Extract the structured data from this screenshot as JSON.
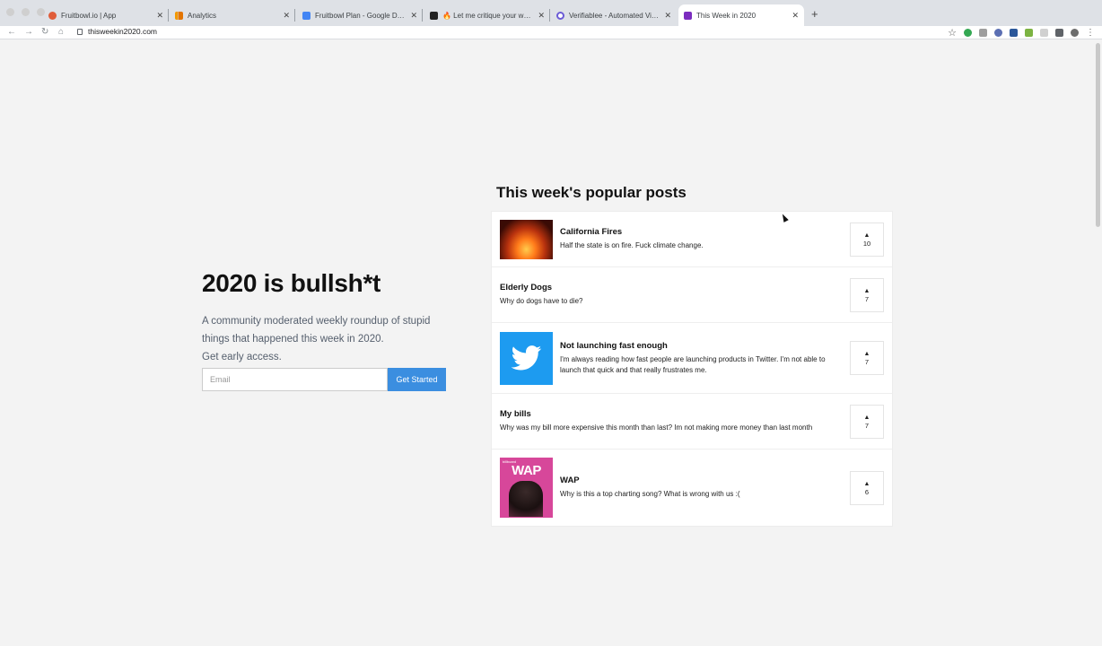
{
  "browser": {
    "tabs": [
      {
        "title": "Fruitbowl.io | App",
        "favicon_color": "#e05d3a",
        "active": false
      },
      {
        "title": "Analytics",
        "favicon_color": "#f29900",
        "active": false
      },
      {
        "title": "Fruitbowl Plan - Google Docs",
        "favicon_color": "#4285f4",
        "active": false
      },
      {
        "title": "🔥 Let me critique your website",
        "favicon_color": "#222222",
        "active": false
      },
      {
        "title": "Verifiablee - Automated Video",
        "favicon_color": "#6b5bd6",
        "active": false
      },
      {
        "title": "This Week in 2020",
        "favicon_color": "#7b2cbf",
        "active": true
      }
    ],
    "close_glyph": "✕",
    "new_tab_glyph": "+",
    "url": "thisweekin2020.com",
    "nav": {
      "back": "←",
      "forward": "→",
      "reload": "↻",
      "home": "⌂"
    },
    "bookmark_glyph": "☆"
  },
  "hero": {
    "title": "2020 is bullsh*t",
    "subtitle_line1": "A community moderated weekly roundup of stupid",
    "subtitle_line2": "things that happened this week in 2020.",
    "subtitle_line3": "Get early access.",
    "email_placeholder": "Email",
    "cta_label": "Get Started"
  },
  "popular": {
    "heading": "This week's popular posts",
    "posts": [
      {
        "title": "California Fires",
        "description": "Half the state is on fire. Fuck climate change.",
        "votes": "10",
        "thumb": "fire"
      },
      {
        "title": "Elderly Dogs",
        "description": "Why do dogs have to die?",
        "votes": "7",
        "thumb": ""
      },
      {
        "title": "Not launching fast enough",
        "description": "I'm always reading how fast people are launching products in Twitter. I'm not able to launch that quick and that really frustrates me.",
        "votes": "7",
        "thumb": "twitter"
      },
      {
        "title": "My bills",
        "description": "Why was my bill more expensive this month than last? Im not making more money than last month",
        "votes": "7",
        "thumb": ""
      },
      {
        "title": "WAP",
        "description": "Why is this a top charting song? What is wrong with us :(",
        "votes": "6",
        "thumb": "wap"
      }
    ],
    "upvote_glyph": "▲"
  },
  "thumb_labels": {
    "wap_big": "WAP",
    "wap_small": "billboard"
  },
  "colors": {
    "accent": "#3b8ee0",
    "twitter": "#1d9bf0",
    "wap_bg": "#d7479a"
  }
}
